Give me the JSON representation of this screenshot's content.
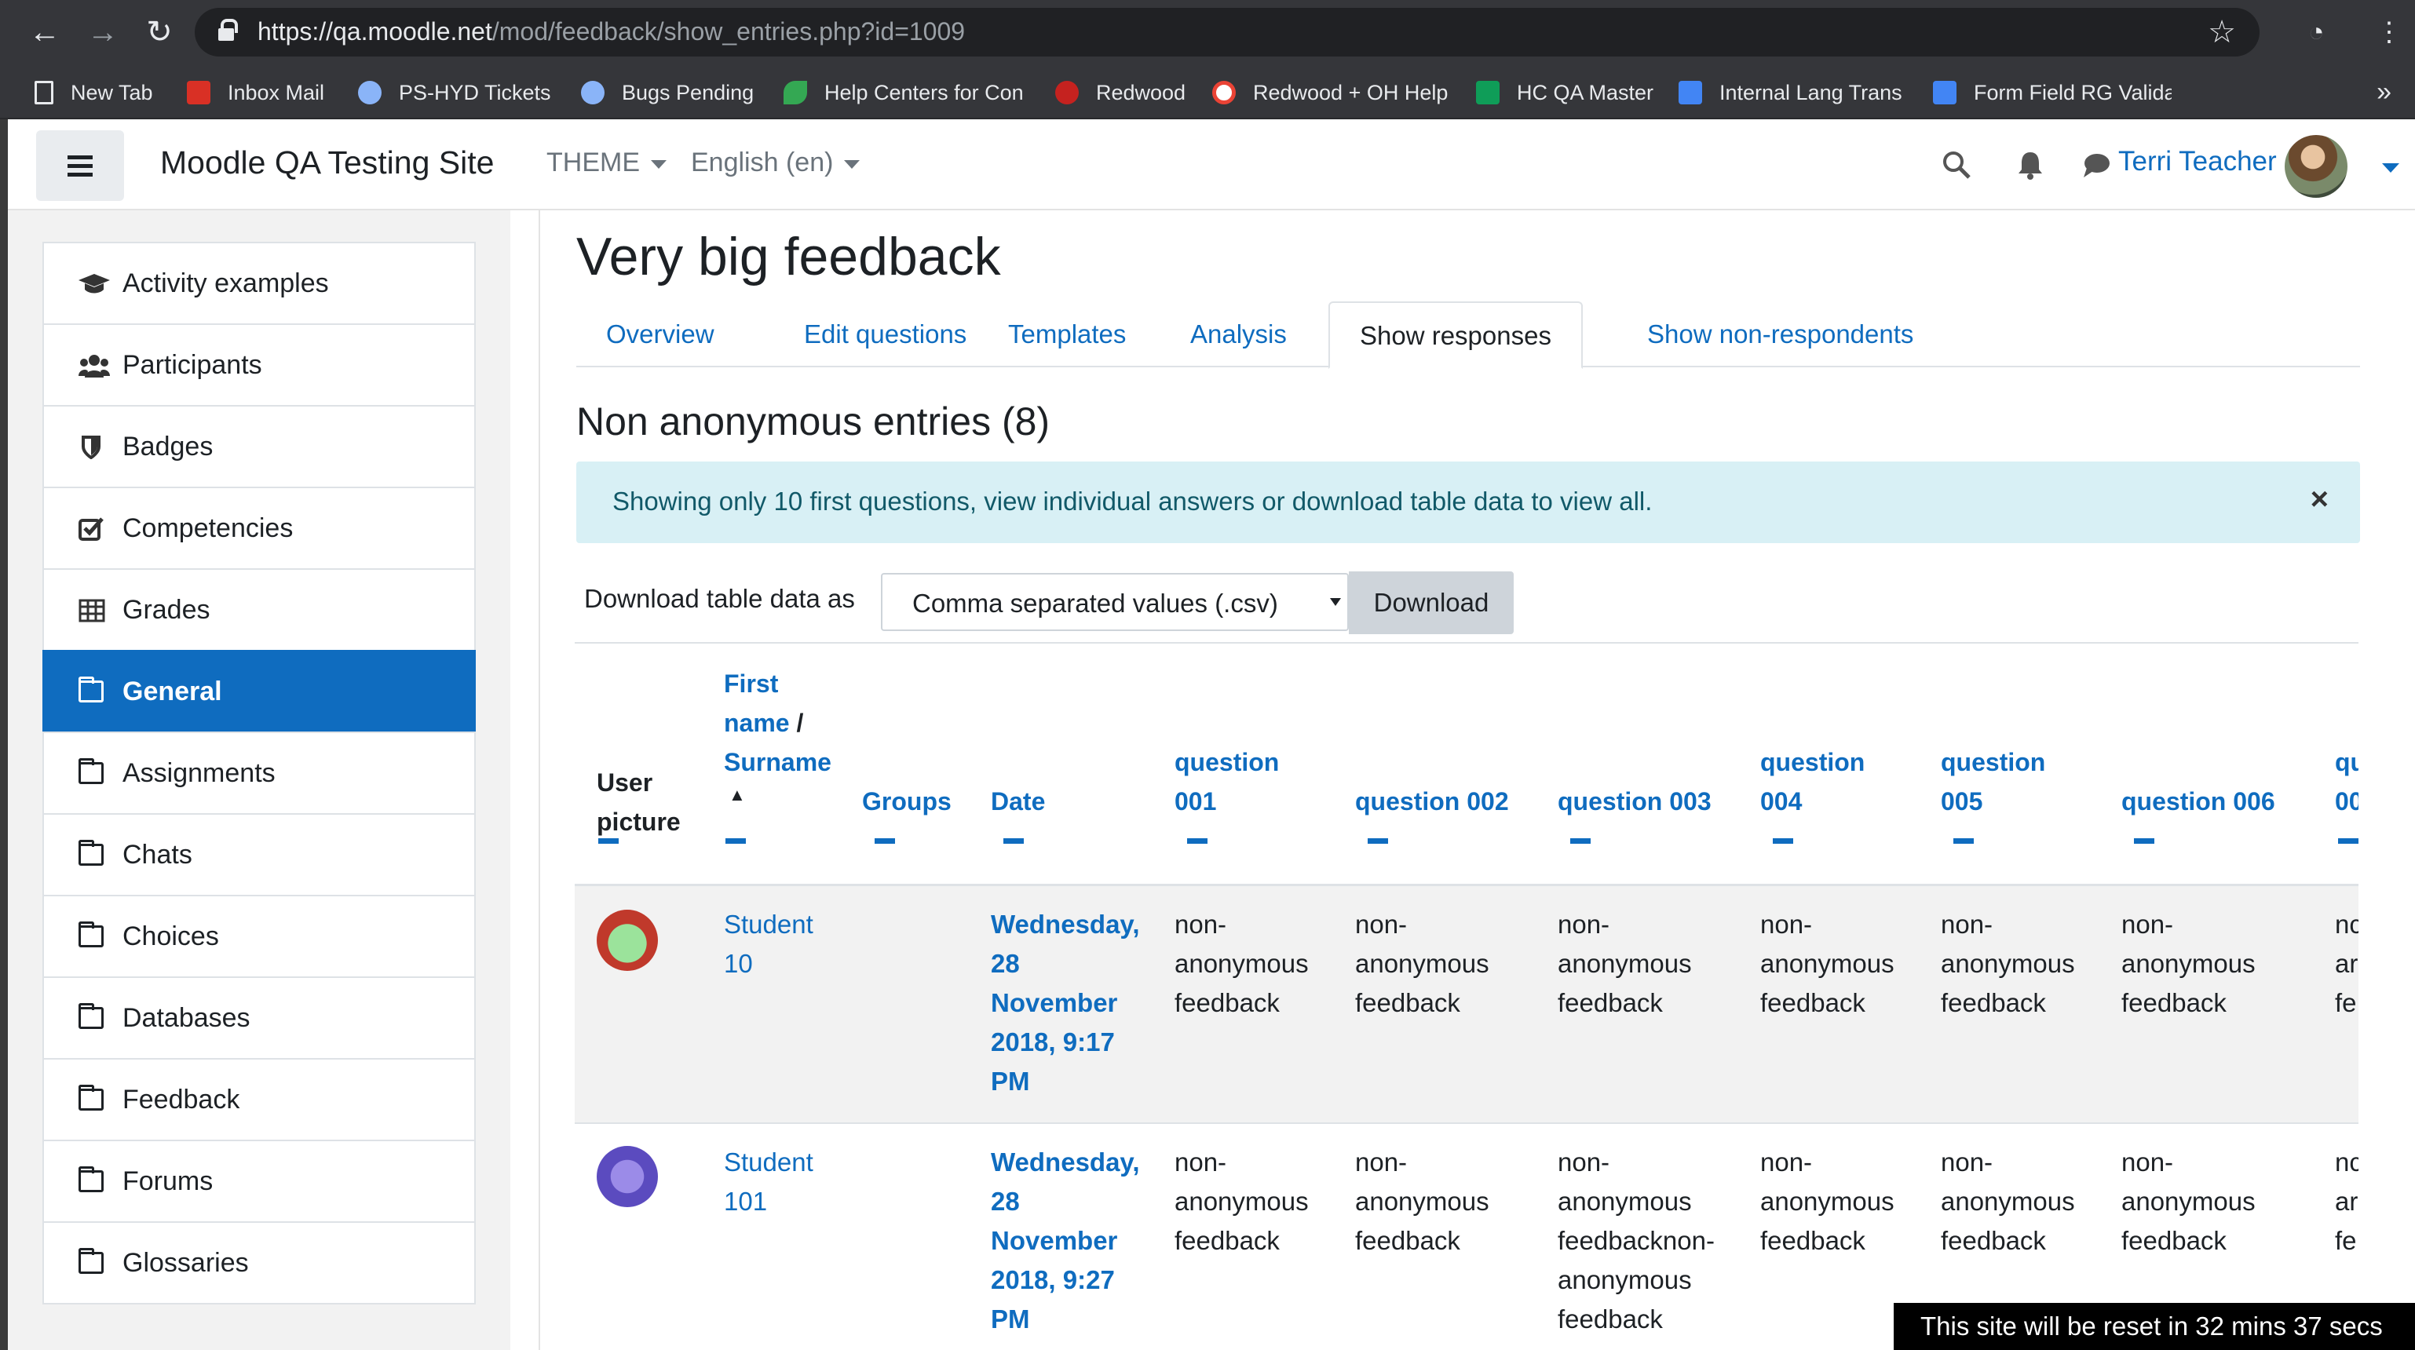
{
  "browser": {
    "url_host": "https://qa.moodle.net",
    "url_path": "/mod/feedback/show_entries.php?id=1009",
    "bookmarks": [
      {
        "label": "New Tab",
        "icon": "page-icon",
        "color": "#e8eaed"
      },
      {
        "label": "Inbox Mail",
        "icon": "gmail-icon",
        "color": "#d93025"
      },
      {
        "label": "PS-HYD Tickets",
        "icon": "jira-icon",
        "color": "#8ab4f8"
      },
      {
        "label": "Bugs Pending",
        "icon": "jira-icon",
        "color": "#8ab4f8"
      },
      {
        "label": "Help Centers for Con",
        "icon": "leaf-icon",
        "color": "#34a853"
      },
      {
        "label": "Redwood",
        "icon": "redwood-icon",
        "color": "#c5221f"
      },
      {
        "label": "Redwood + OH Help",
        "icon": "google-icon",
        "color": "#ffffff"
      },
      {
        "label": "HC QA Master",
        "icon": "sheets-icon",
        "color": "#0f9d58"
      },
      {
        "label": "Internal Lang Trans",
        "icon": "docs-icon",
        "color": "#4285f4"
      },
      {
        "label": "Form Field RG Valida",
        "icon": "docs-icon",
        "color": "#4285f4"
      }
    ],
    "more": "»"
  },
  "navbar": {
    "site_name": "Moodle QA Testing Site",
    "theme_menu": "THEME",
    "language_menu": "English (en)",
    "user_name": "Terri Teacher"
  },
  "sidebar": {
    "items": [
      {
        "label": "Activity examples",
        "icon": "graduation-cap-icon"
      },
      {
        "label": "Participants",
        "icon": "users-icon"
      },
      {
        "label": "Badges",
        "icon": "shield-icon"
      },
      {
        "label": "Competencies",
        "icon": "checkbox-icon"
      },
      {
        "label": "Grades",
        "icon": "table-icon"
      },
      {
        "label": "General",
        "icon": "folder-icon",
        "active": true
      },
      {
        "label": "Assignments",
        "icon": "folder-icon"
      },
      {
        "label": "Chats",
        "icon": "folder-icon"
      },
      {
        "label": "Choices",
        "icon": "folder-icon"
      },
      {
        "label": "Databases",
        "icon": "folder-icon"
      },
      {
        "label": "Feedback",
        "icon": "folder-icon"
      },
      {
        "label": "Forums",
        "icon": "folder-icon"
      },
      {
        "label": "Glossaries",
        "icon": "folder-icon"
      }
    ]
  },
  "main": {
    "title": "Very big feedback",
    "tabs": [
      "Overview",
      "Edit questions",
      "Templates",
      "Analysis",
      "Show responses",
      "Show non-respondents"
    ],
    "active_tab": "Show responses",
    "subheading": "Non anonymous entries (8)",
    "alert": "Showing only 10 first questions, view individual answers or download table data to view all.",
    "alert_close": "×",
    "download_label": "Download table data as",
    "download_format": "Comma separated values (.csv)",
    "download_button": "Download"
  },
  "table": {
    "headers": {
      "user_picture": [
        "User",
        "picture"
      ],
      "first_name": [
        "First",
        "name"
      ],
      "name_sep": "/",
      "surname": "Surname",
      "sort_arrow": "▲",
      "groups": "Groups",
      "date": "Date",
      "q001": [
        "question",
        "001"
      ],
      "q002": "question 002",
      "q003": "question 003",
      "q004": [
        "question",
        "004"
      ],
      "q005": [
        "question",
        "005"
      ],
      "q006": "question 006",
      "q007_partial": [
        "qu",
        "00"
      ]
    },
    "rows": [
      {
        "name": [
          "Student",
          "10"
        ],
        "date": [
          "Wednesday,",
          "28",
          "November",
          "2018, 9:17",
          "PM"
        ],
        "answers": [
          [
            "non-",
            "anonymous",
            "feedback"
          ],
          [
            "non-",
            "anonymous",
            "feedback"
          ],
          [
            "non-",
            "anonymous",
            "feedback"
          ],
          [
            "non-",
            "anonymous",
            "feedback"
          ],
          [
            "non-",
            "anonymous",
            "feedback"
          ],
          [
            "non-",
            "anonymous",
            "feedback"
          ],
          [
            "nc",
            "ar",
            "fe"
          ]
        ]
      },
      {
        "name": [
          "Student",
          "101"
        ],
        "date": [
          "Wednesday,",
          "28",
          "November",
          "2018, 9:27",
          "PM"
        ],
        "answers": [
          [
            "non-",
            "anonymous",
            "feedback"
          ],
          [
            "non-",
            "anonymous",
            "feedback"
          ],
          [
            "non-",
            "anonymous",
            "feedbacknon-",
            "anonymous",
            "feedback"
          ],
          [
            "non-",
            "anonymous",
            "feedback"
          ],
          [
            "non-",
            "anonymous",
            "feedback"
          ],
          [
            "non-",
            "anonymous",
            "feedback"
          ],
          [
            "nc",
            "ar",
            "fe"
          ]
        ]
      }
    ]
  },
  "footer": {
    "reset_notice": "This site will be reset in 32 mins 37 secs"
  }
}
